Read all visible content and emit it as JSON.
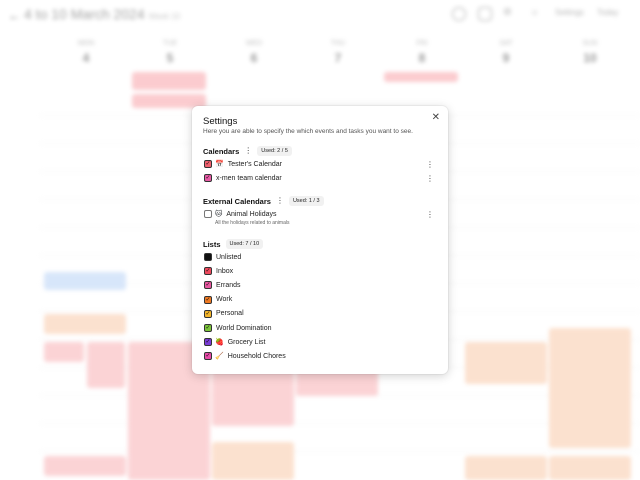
{
  "header": {
    "back_icon": "arrow-left-icon",
    "date_range": "4 to 10 March 2024",
    "week_label": "Week 10",
    "buttons": [
      "Settings",
      "Today"
    ]
  },
  "days": [
    {
      "name": "MON",
      "num": "4"
    },
    {
      "name": "TUE",
      "num": "5"
    },
    {
      "name": "WED",
      "num": "6"
    },
    {
      "name": "THU",
      "num": "7"
    },
    {
      "name": "FRI",
      "num": "8"
    },
    {
      "name": "SAT",
      "num": "9"
    },
    {
      "name": "SUN",
      "num": "10"
    }
  ],
  "modal": {
    "title": "Settings",
    "description": "Here you are able to specify the which events and tasks you want to see.",
    "close_icon": "close-icon",
    "calendars": {
      "title": "Calendars",
      "badge": "Used: 2 / 5",
      "items": [
        {
          "label": "Tester's Calendar",
          "emoji": "📅",
          "color": "#f0606e",
          "checked": true
        },
        {
          "label": "x-men team calendar",
          "emoji": "",
          "color": "#e85aa6",
          "checked": true
        }
      ]
    },
    "external": {
      "title": "External Calendars",
      "badge": "Used: 1 / 3",
      "items": [
        {
          "label": "Animal Holidays",
          "emoji": "🐱",
          "subtitle": "All the holidays related to animals",
          "checked": false
        }
      ]
    },
    "lists": {
      "title": "Lists",
      "badge": "Used: 7 / 10",
      "items": [
        {
          "label": "Unlisted",
          "emoji": "",
          "color": "#111111",
          "checked": true
        },
        {
          "label": "Inbox",
          "emoji": "",
          "color": "#f04a5e",
          "checked": true
        },
        {
          "label": "Errands",
          "emoji": "",
          "color": "#e857a0",
          "checked": true
        },
        {
          "label": "Work",
          "emoji": "",
          "color": "#f07a22",
          "checked": true
        },
        {
          "label": "Personal",
          "emoji": "",
          "color": "#f5b62a",
          "checked": true
        },
        {
          "label": "World Domination",
          "emoji": "",
          "color": "#7cc63a",
          "checked": true
        },
        {
          "label": "Grocery List",
          "emoji": "🍓",
          "color": "#7a3cd6",
          "checked": true
        },
        {
          "label": "Household Chores",
          "emoji": "🧹",
          "color": "#e84aa8",
          "checked": true
        }
      ]
    }
  }
}
